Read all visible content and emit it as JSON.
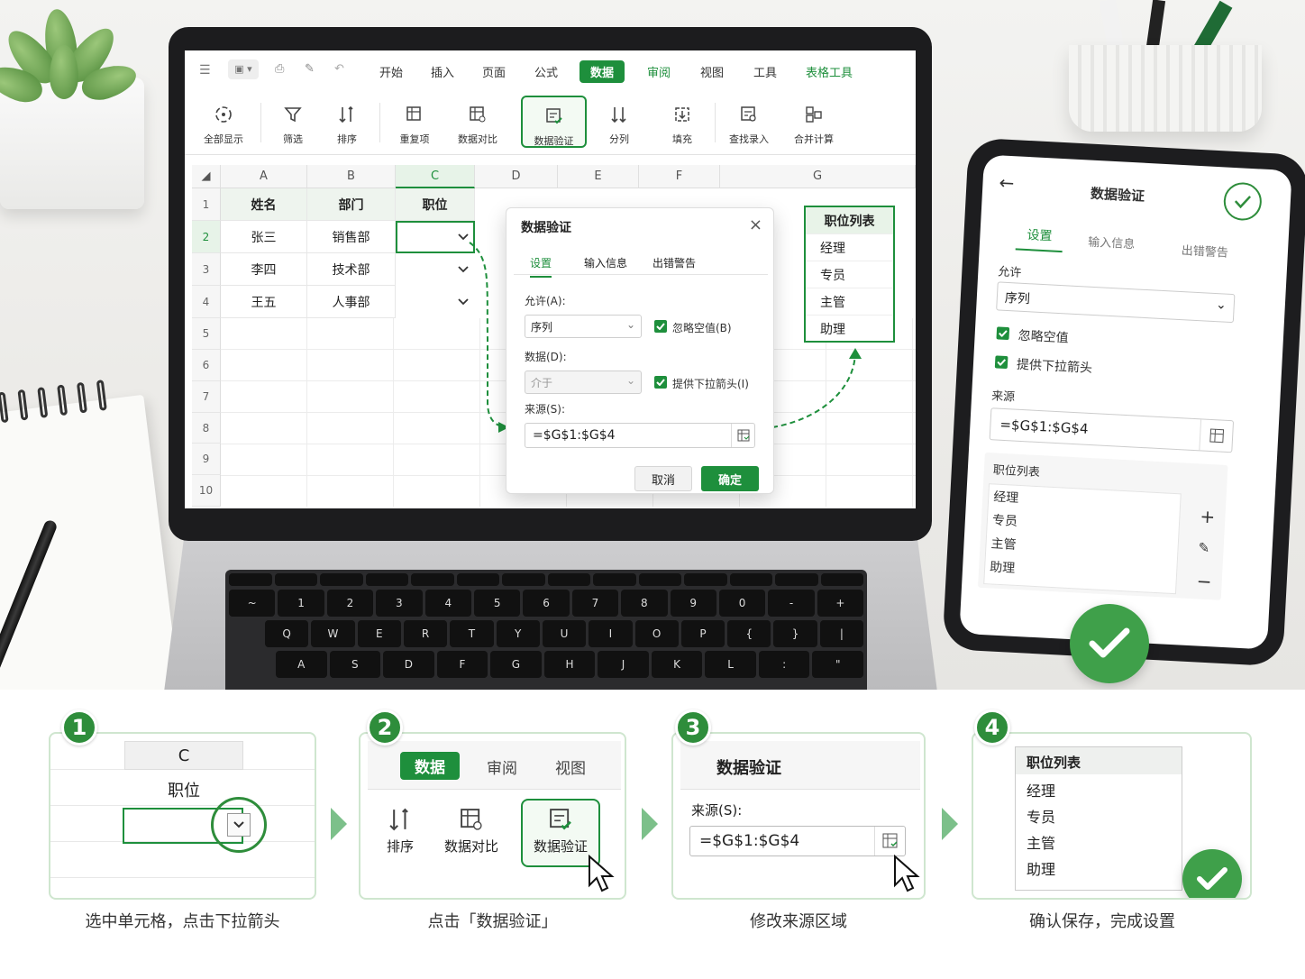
{
  "menu": {
    "items": [
      "开始",
      "插入",
      "页面",
      "公式",
      "数据",
      "审阅",
      "视图",
      "工具",
      "表格工具"
    ],
    "active": "数据"
  },
  "ribbon": {
    "buttons": [
      "全部显示",
      "筛选",
      "排序",
      "重复项",
      "数据对比",
      "数据验证",
      "分列",
      "填充",
      "查找录入",
      "合并计算"
    ],
    "active": "数据验证"
  },
  "sheet": {
    "columns": [
      "A",
      "B",
      "C",
      "D",
      "E",
      "F",
      "G"
    ],
    "rows": [
      "1",
      "2",
      "3",
      "4",
      "5",
      "6",
      "7",
      "8",
      "9",
      "10"
    ],
    "header_row": [
      "姓名",
      "部门",
      "职位"
    ],
    "data": [
      [
        "张三",
        "销售部"
      ],
      [
        "李四",
        "技术部"
      ],
      [
        "王五",
        "人事部"
      ]
    ]
  },
  "dialog": {
    "title": "数据验证",
    "tabs": [
      "设置",
      "输入信息",
      "出错警告"
    ],
    "allow_label": "允许(A):",
    "allow_value": "序列",
    "ignore_blank": "忽略空值(B)",
    "data_label": "数据(D):",
    "data_value": "介于",
    "dropdown": "提供下拉箭头(I)",
    "source_label": "来源(S):",
    "source_value": "=$G$1:$G$4",
    "cancel": "取消",
    "ok": "确定"
  },
  "glist": {
    "title": "职位列表",
    "items": [
      "经理",
      "专员",
      "主管",
      "助理"
    ]
  },
  "tablet": {
    "title": "数据验证",
    "tabs": [
      "设置",
      "输入信息",
      "出错警告"
    ],
    "allow_label": "允许",
    "allow_value": "序列",
    "ignore_blank": "忽略空值",
    "dropdown": "提供下拉箭头",
    "source_label": "来源",
    "source_value": "=$G$1:$G$4",
    "list_title": "职位列表",
    "list_items": [
      "经理",
      "专员",
      "主管",
      "助理"
    ]
  },
  "steps": [
    {
      "n": "1",
      "caption": "选中单元格，点击下拉箭头",
      "col": "C",
      "cell": "职位"
    },
    {
      "n": "2",
      "caption": "点击「数据验证」",
      "tabs": [
        "数据",
        "审阅",
        "视图"
      ],
      "buttons": [
        "排序",
        "数据对比",
        "数据验证"
      ]
    },
    {
      "n": "3",
      "caption": "修改来源区域",
      "title": "数据验证",
      "label": "来源(S):",
      "value": "=$G$1:$G$4"
    },
    {
      "n": "4",
      "caption": "确认保存，完成设置",
      "title": "职位列表",
      "items": [
        "经理",
        "专员",
        "主管",
        "助理"
      ]
    }
  ],
  "keyboard": {
    "row1": [
      "~",
      "1",
      "2",
      "3",
      "4",
      "5",
      "6",
      "7",
      "8",
      "9",
      "0",
      "-",
      "+"
    ],
    "row2": [
      "Q",
      "W",
      "E",
      "R",
      "T",
      "Y",
      "U",
      "I",
      "O",
      "P",
      "{",
      "}",
      "|"
    ],
    "row3": [
      "A",
      "S",
      "D",
      "F",
      "G",
      "H",
      "J",
      "K",
      "L",
      ":",
      "\""
    ]
  },
  "colors": {
    "accent": "#1e8f3c",
    "check": "#3fa04a"
  }
}
